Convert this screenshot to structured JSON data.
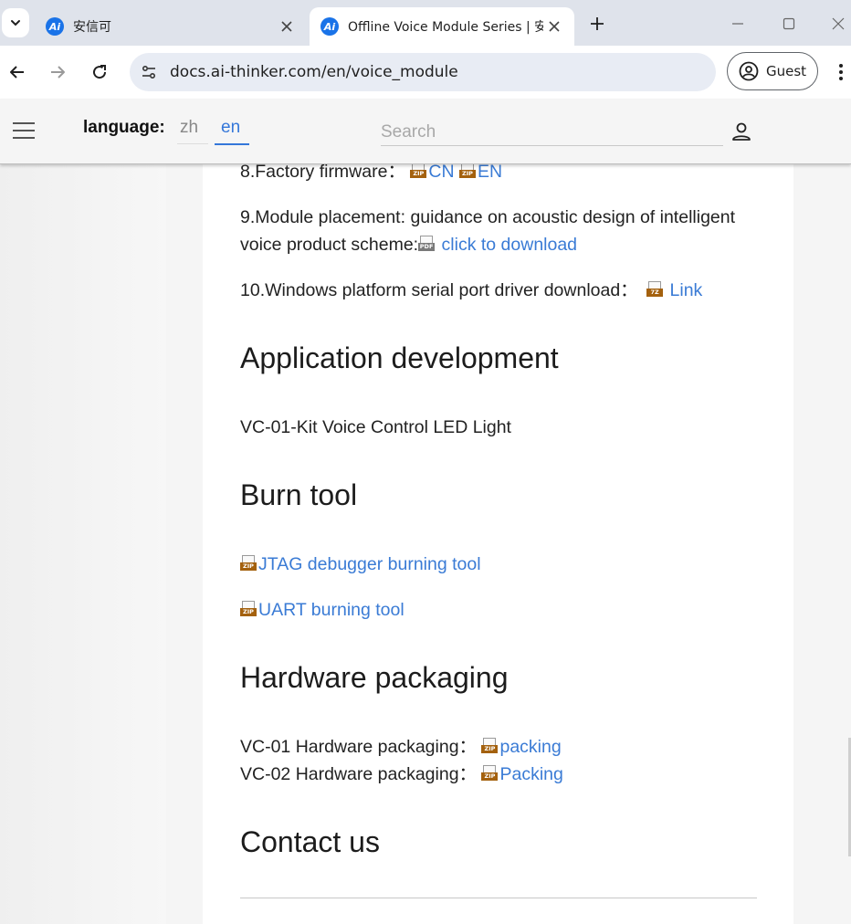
{
  "browser": {
    "tabs": [
      {
        "title": "安信可",
        "active": false
      },
      {
        "title": "Offline Voice Module Series | 安",
        "active": true
      }
    ],
    "url": "docs.ai-thinker.com/en/voice_module",
    "profile_label": "Guest"
  },
  "site_header": {
    "language_label": "language:",
    "languages": [
      "zh",
      "en"
    ],
    "active_language": "en",
    "search_placeholder": "Search"
  },
  "content": {
    "item8": {
      "text": "8.Factory firmware：",
      "links": [
        "CN",
        "EN"
      ]
    },
    "item9": {
      "line1": "9.Module placement: guidance on acoustic design of intelligent",
      "line2": "voice product scheme:",
      "link": "click to download"
    },
    "item10": {
      "text": "10.Windows platform serial port driver download：",
      "link": "Link"
    },
    "app_dev": {
      "heading": "Application development",
      "text": "VC-01-Kit Voice Control LED Light"
    },
    "burn_tool": {
      "heading": "Burn tool",
      "links": [
        "JTAG debugger burning tool",
        "UART burning tool"
      ]
    },
    "hardware": {
      "heading": "Hardware packaging",
      "rows": [
        {
          "text": "VC-01 Hardware packaging：",
          "link": "packing"
        },
        {
          "text": "VC-02 Hardware packaging：",
          "link": "Packing"
        }
      ]
    },
    "contact": {
      "heading": "Contact us"
    }
  },
  "icons": {
    "zip_badge": "ZIP",
    "pdf_badge": "PDF",
    "sevenz_badge": "7Z"
  },
  "colors": {
    "link": "#3a7bd5",
    "tab_strip": "#dfe3eb",
    "omnibox": "#e8ecf4",
    "zip_badge": "#a4610e"
  }
}
